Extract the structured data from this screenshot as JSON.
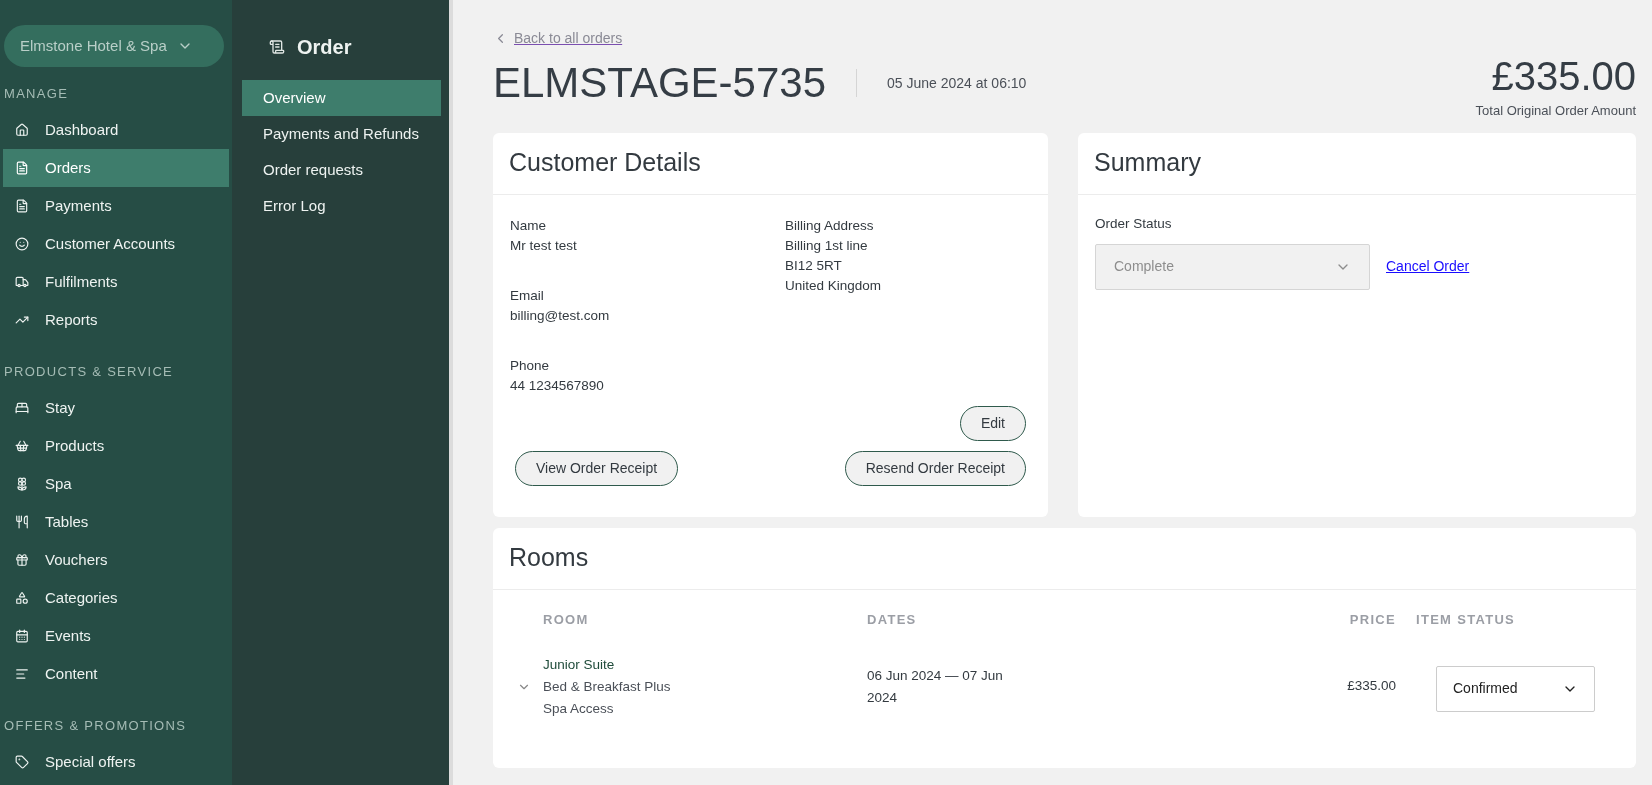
{
  "property_selector": {
    "label": "Elmstone Hotel & Spa"
  },
  "sidebar": {
    "sections": [
      {
        "title": "MANAGE",
        "items": [
          {
            "label": "Dashboard",
            "selected": false
          },
          {
            "label": "Orders",
            "selected": true
          },
          {
            "label": "Payments",
            "selected": false
          },
          {
            "label": "Customer Accounts",
            "selected": false
          },
          {
            "label": "Fulfilments",
            "selected": false
          },
          {
            "label": "Reports",
            "selected": false
          }
        ]
      },
      {
        "title": "PRODUCTS & SERVICE",
        "items": [
          {
            "label": "Stay",
            "selected": false
          },
          {
            "label": "Products",
            "selected": false
          },
          {
            "label": "Spa",
            "selected": false
          },
          {
            "label": "Tables",
            "selected": false
          },
          {
            "label": "Vouchers",
            "selected": false
          },
          {
            "label": "Categories",
            "selected": false
          },
          {
            "label": "Events",
            "selected": false
          },
          {
            "label": "Content",
            "selected": false
          }
        ]
      },
      {
        "title": "OFFERS & PROMOTIONS",
        "items": [
          {
            "label": "Special offers",
            "selected": false
          }
        ]
      }
    ]
  },
  "subnav": {
    "title": "Order",
    "items": [
      {
        "label": "Overview",
        "selected": true
      },
      {
        "label": "Payments and Refunds",
        "selected": false
      },
      {
        "label": "Order requests",
        "selected": false
      },
      {
        "label": "Error Log",
        "selected": false
      }
    ]
  },
  "header": {
    "back_link": "Back to all orders",
    "order_id": "ELMSTAGE-5735",
    "date": "05 June 2024 at 06:10",
    "total": "£335.00",
    "total_label": "Total Original Order Amount"
  },
  "customer_details": {
    "title": "Customer Details",
    "left_fields": [
      {
        "label": "Name",
        "lines": [
          "Mr test test"
        ]
      },
      {
        "label": "Email",
        "lines": [
          "billing@test.com"
        ]
      },
      {
        "label": "Phone",
        "lines": [
          "44 1234567890"
        ]
      }
    ],
    "right_fields": [
      {
        "label": "Billing Address",
        "lines": [
          "Billing 1st line",
          "BI12 5RT",
          "United Kingdom"
        ]
      }
    ],
    "edit_button": "Edit",
    "view_receipt_button": "View Order Receipt",
    "resend_receipt_button": "Resend Order Receipt"
  },
  "summary": {
    "title": "Summary",
    "status_label": "Order Status",
    "status_value": "Complete",
    "status_disabled": true,
    "cancel_link": "Cancel Order"
  },
  "rooms": {
    "title": "Rooms",
    "columns": [
      "ROOM",
      "DATES",
      "PRICE",
      "ITEM STATUS"
    ],
    "rows": [
      {
        "expanded": false,
        "room": "Junior Suite",
        "details": [
          "Bed & Breakfast Plus",
          "Spa Access"
        ],
        "dates": "06 Jun 2024 — 07 Jun 2024",
        "price": "£335.00",
        "status": "Confirmed"
      }
    ]
  }
}
